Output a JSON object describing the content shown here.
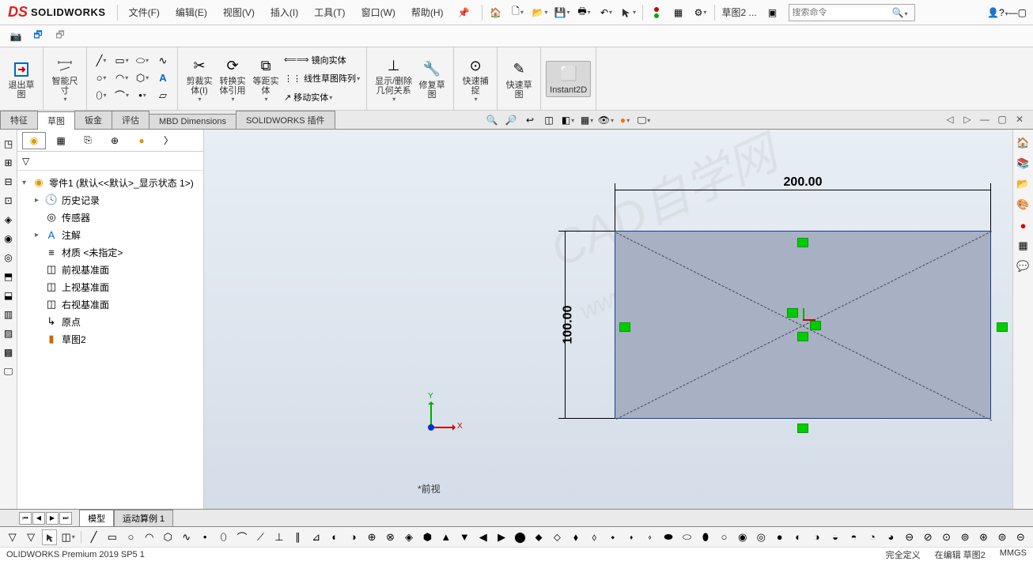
{
  "app": {
    "logo_ds": "DS",
    "logo_sw": "SOLIDWORKS"
  },
  "menu": {
    "file": "文件(F)",
    "edit": "编辑(E)",
    "view": "视图(V)",
    "insert": "插入(I)",
    "tools": "工具(T)",
    "window": "窗口(W)",
    "help": "帮助(H)"
  },
  "top": {
    "doc_name": "草图2 ...",
    "search_placeholder": "搜索命令"
  },
  "ribbon": {
    "exit_sketch": "退出草\n图",
    "smart_dim": "智能尺\n寸",
    "trim": "剪裁实\n体(I)",
    "convert": "转换实\n体引用",
    "offset": "等距实\n体",
    "mirror": "镜向实体",
    "linear_pattern": "线性草图阵列",
    "move": "移动实体",
    "show_rel": "显示/删除\n几何关系",
    "repair": "修复草\n图",
    "quick_snap": "快速捕\n捉",
    "rapid_sketch": "快速草\n图",
    "instant2d": "Instant2D"
  },
  "tabs": {
    "feature": "特征",
    "sketch": "草图",
    "sheetmetal": "钣金",
    "eval": "评估",
    "mbd": "MBD Dimensions",
    "addin": "SOLIDWORKS 插件"
  },
  "tree": {
    "root": "零件1  (默认<<默认>_显示状态 1>)",
    "history": "历史记录",
    "sensors": "传感器",
    "annot": "注解",
    "material": "材质 <未指定>",
    "front": "前视基准面",
    "top": "上视基准面",
    "right": "右视基准面",
    "origin": "原点",
    "sketch2": "草图2"
  },
  "dims": {
    "width": "200.00",
    "height": "100.00"
  },
  "view_name": "*前视",
  "bottom_tabs": {
    "model": "模型",
    "motion": "运动算例 1"
  },
  "status": {
    "app": "OLIDWORKS Premium 2019 SP5 1",
    "def": "完全定义",
    "edit": "在编辑 草图2",
    "units": "MMGS"
  }
}
